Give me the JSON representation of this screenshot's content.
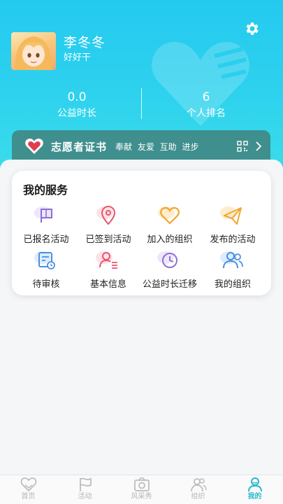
{
  "profile": {
    "name": "李冬冬",
    "motto": "好好干"
  },
  "stats": [
    {
      "value": "0.0",
      "label": "公益时长"
    },
    {
      "value": "6",
      "label": "个人排名"
    }
  ],
  "certificate": {
    "title": "志愿者证书",
    "tags": "奉献 友爱 互助 进步"
  },
  "services": {
    "title": "我的服务",
    "items": [
      {
        "label": "已报名活动",
        "icon": "flag-icon",
        "color": "#8b6fd6"
      },
      {
        "label": "已签到活动",
        "icon": "location-pin-icon",
        "color": "#e8566f"
      },
      {
        "label": "加入的组织",
        "icon": "heart-icon",
        "color": "#f0a62b"
      },
      {
        "label": "发布的活动",
        "icon": "send-icon",
        "color": "#f0a62b"
      },
      {
        "label": "待审核",
        "icon": "calendar-clock-icon",
        "color": "#4a8fe0"
      },
      {
        "label": "基本信息",
        "icon": "user-card-icon",
        "color": "#e8566f"
      },
      {
        "label": "公益时长迁移",
        "icon": "clock-icon",
        "color": "#8b6fd6"
      },
      {
        "label": "我的组织",
        "icon": "users-icon",
        "color": "#4a8fe0"
      }
    ]
  },
  "tabs": [
    {
      "label": "首页",
      "icon": "heart-hand-icon"
    },
    {
      "label": "活动",
      "icon": "flag-icon"
    },
    {
      "label": "风采秀",
      "icon": "camera-icon"
    },
    {
      "label": "组织",
      "icon": "users-icon"
    },
    {
      "label": "我的",
      "icon": "profile-icon",
      "active": true
    }
  ],
  "colors": {
    "header": "#24c9ef",
    "cert_bar": "#3f8f8e",
    "accent": "#2bb8cf"
  }
}
